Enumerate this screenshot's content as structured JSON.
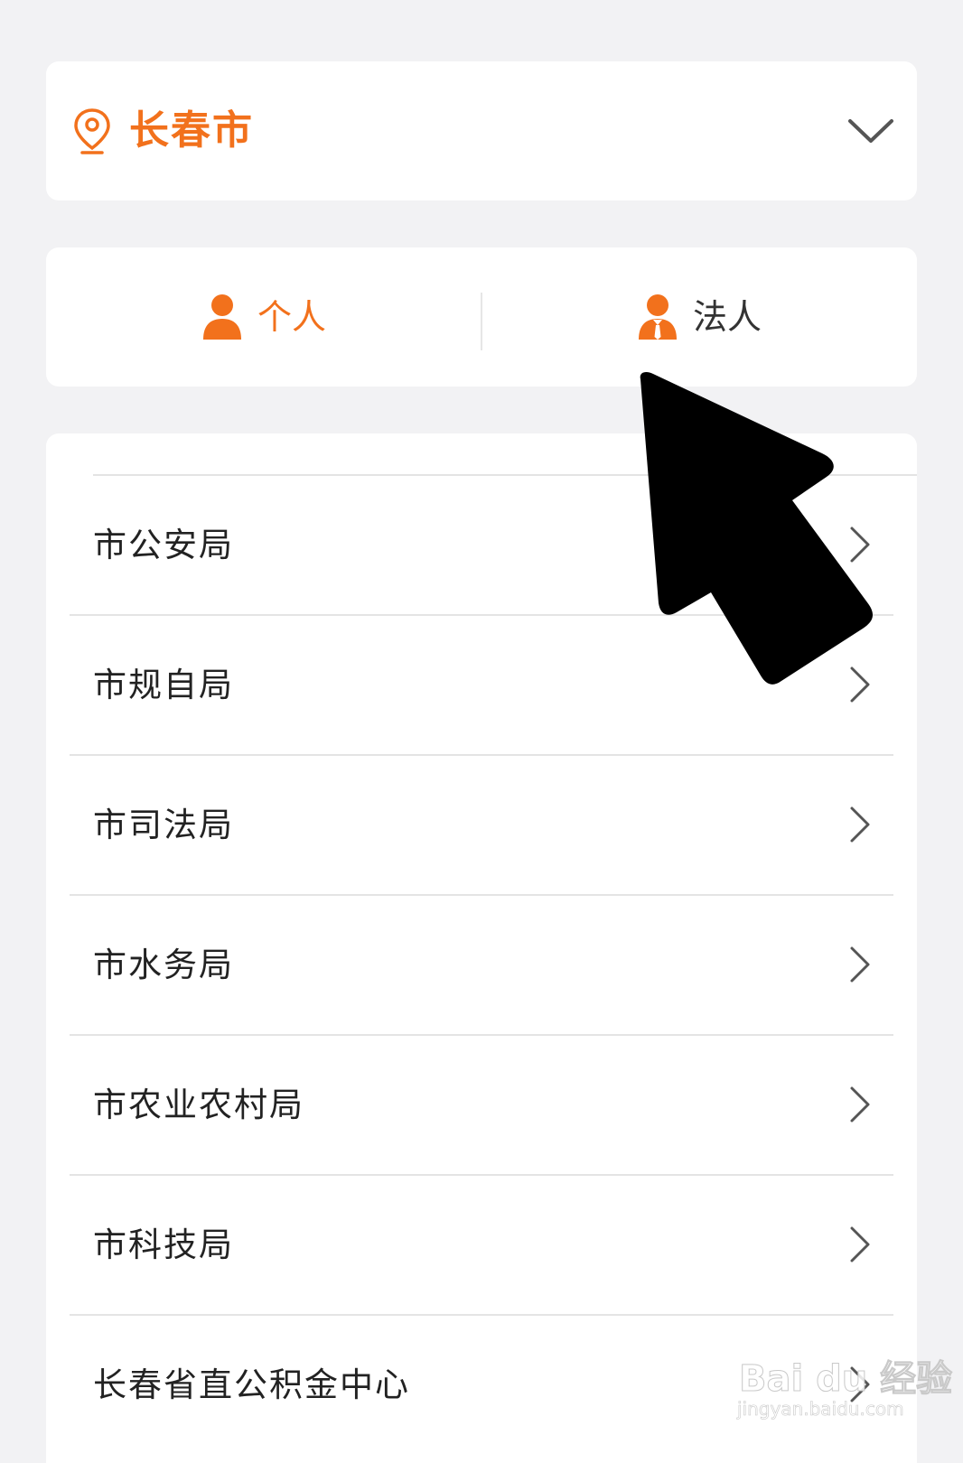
{
  "colors": {
    "accent": "#f2711c",
    "background": "#f2f2f4",
    "card": "#ffffff",
    "text": "#222222",
    "divider": "#e4e4e4",
    "chevron": "#555555"
  },
  "city_selector": {
    "city": "长春市",
    "icon": "location-pin-icon",
    "dropdown_icon": "chevron-down-icon"
  },
  "type_tabs": [
    {
      "label": "个人",
      "icon": "person-icon",
      "selected": true
    },
    {
      "label": "法人",
      "icon": "business-person-icon",
      "selected": false
    }
  ],
  "departments": [
    {
      "label": "市公安局"
    },
    {
      "label": "市规自局"
    },
    {
      "label": "市司法局"
    },
    {
      "label": "市水务局"
    },
    {
      "label": "市农业农村局"
    },
    {
      "label": "市科技局"
    },
    {
      "label": "长春省直公积金中心"
    }
  ],
  "watermark": {
    "logo": "Bai du 经验",
    "url": "jingyan.baidu.com"
  }
}
